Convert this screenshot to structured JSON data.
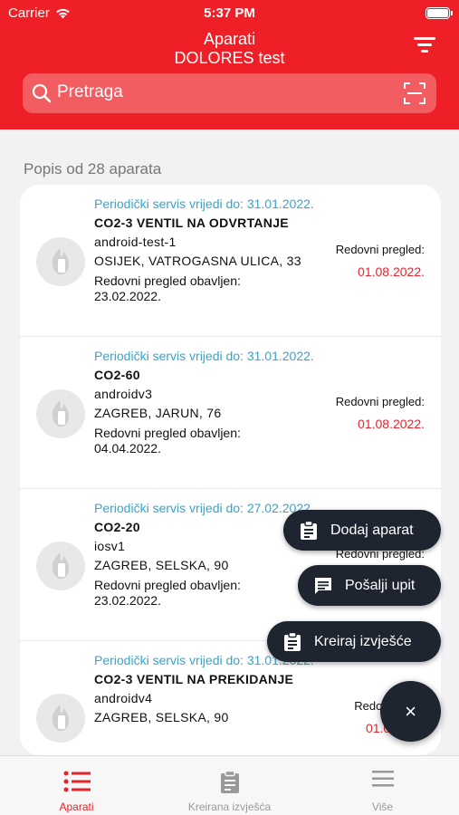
{
  "status_bar": {
    "carrier": "Carrier",
    "time": "5:37 PM"
  },
  "header": {
    "title": "Aparati",
    "subtitle": "DOLORES test"
  },
  "search": {
    "placeholder": "Pretraga"
  },
  "list": {
    "title": "Popis od 28 aparata",
    "items": [
      {
        "service": "Periodički servis vrijedi do: 31.01.2022.",
        "name": "CO2-3 VENTIL NA ODVRTANJE",
        "device": "android-test-1",
        "location": "OSIJEK, VATROGASNA ULICA, 33",
        "done_label": "Redovni pregled obavljen:",
        "done_date": "23.02.2022.",
        "next_label": "Redovni pregled:",
        "next_date": "01.08.2022."
      },
      {
        "service": "Periodički servis vrijedi do: 31.01.2022.",
        "name": "CO2-60",
        "device": "androidv3",
        "location": "ZAGREB, JARUN, 76",
        "done_label": "Redovni pregled obavljen:",
        "done_date": "04.04.2022.",
        "next_label": "Redovni pregled:",
        "next_date": "01.08.2022."
      },
      {
        "service": "Periodički servis vrijedi do: 27.02.2022.",
        "name": "CO2-20",
        "device": "iosv1",
        "location": "ZAGREB, SELSKA, 90",
        "done_label": "Redovni pregled obavljen:",
        "done_date": "23.02.2022.",
        "next_label": "Redovni pregled:",
        "next_date": ""
      },
      {
        "service": "Periodički servis vrijedi do: 31.01.2022.",
        "name": "CO2-3 VENTIL NA PREKIDANJE",
        "device": "androidv4",
        "location": "ZAGREB, SELSKA, 90",
        "done_label": "",
        "done_date": "",
        "next_label": "Redovni",
        "next_date": "01.08"
      }
    ]
  },
  "fab_menu": {
    "add": "Dodaj aparat",
    "send": "Pošalji upit",
    "report": "Kreiraj izvješće",
    "close": "×"
  },
  "tabbar": {
    "tabs": [
      {
        "label": "Aparati",
        "icon": "list-icon"
      },
      {
        "label": "Kreirana izvješća",
        "icon": "clipboard-icon"
      },
      {
        "label": "Više",
        "icon": "menu-icon"
      }
    ]
  },
  "colors": {
    "primary": "#ee1f26",
    "service_text": "#3aa3c9",
    "fab": "#1e2530"
  }
}
